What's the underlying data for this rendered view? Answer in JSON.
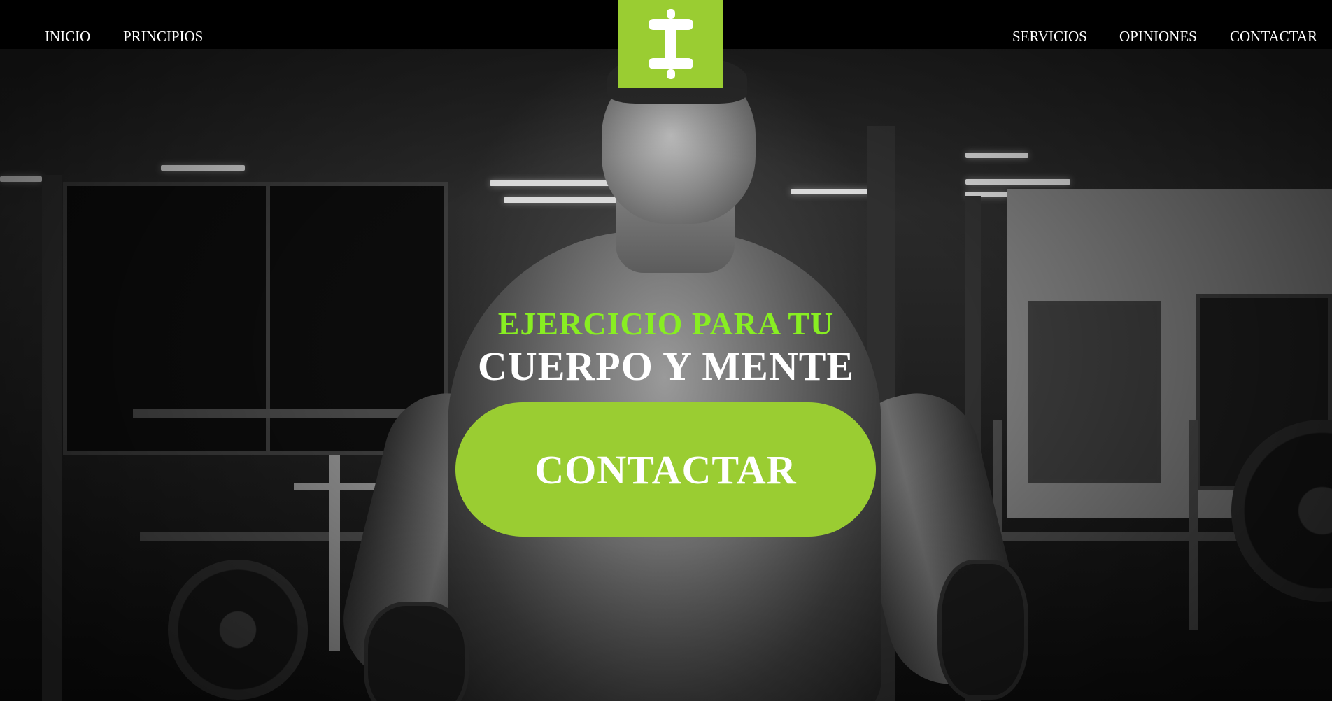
{
  "nav": {
    "left": [
      {
        "label": "INICIO"
      },
      {
        "label": "PRINCIPIOS"
      }
    ],
    "right": [
      {
        "label": "SERVICIOS"
      },
      {
        "label": "OPINIONES"
      },
      {
        "label": "CONTACTAR"
      }
    ],
    "logo_icon": "dumbbell-icon"
  },
  "hero": {
    "headline_line1": "EJERCICIO PARA TU",
    "headline_line2": "CUERPO Y MENTE",
    "cta_label": "CONTACTAR"
  },
  "colors": {
    "accent": "#9acd32",
    "headline_accent": "#88ee22",
    "navbar": "#000000",
    "text": "#ffffff"
  }
}
